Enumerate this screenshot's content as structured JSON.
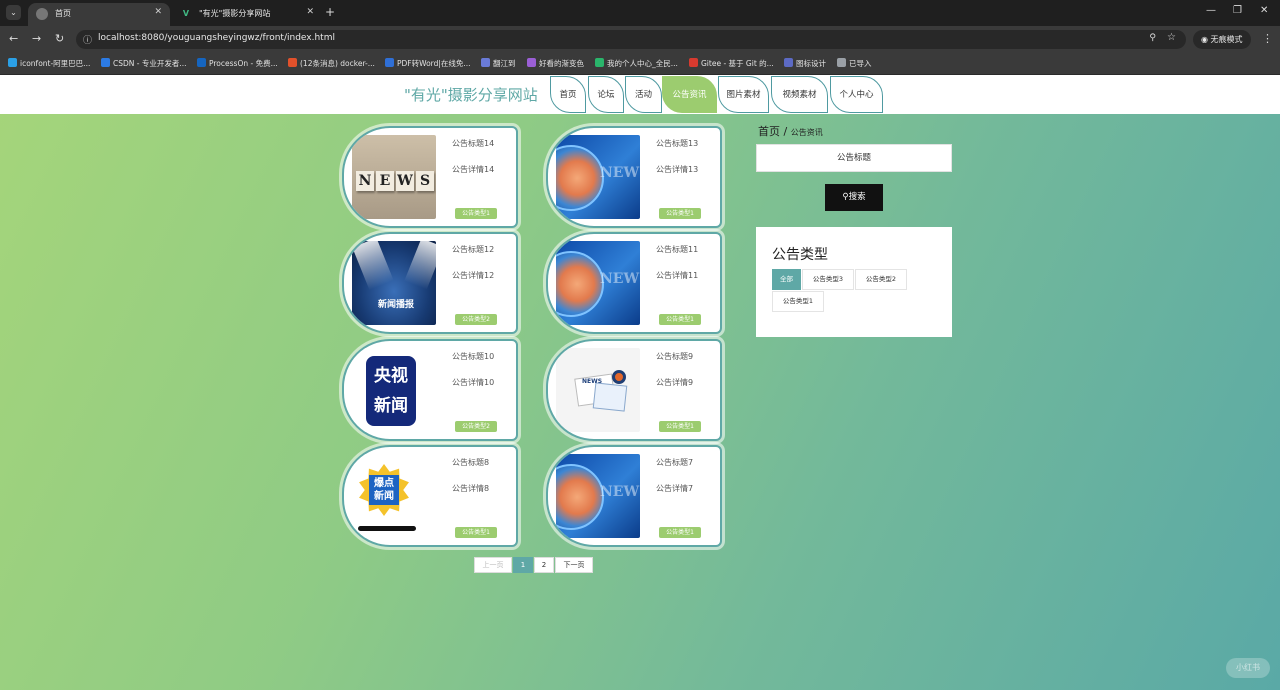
{
  "browser": {
    "tabs": [
      {
        "title": "首页",
        "active": true
      },
      {
        "title": "\"有光\"摄影分享网站",
        "active": false
      }
    ],
    "url": "localhost:8080/youguangsheyingwz/front/index.html",
    "incognito_label": "无痕模式",
    "bookmarks": [
      {
        "label": "iconfont-阿里巴巴...",
        "color": "#2ba0e6"
      },
      {
        "label": "CSDN - 专业开发者...",
        "color": "#2c7be5"
      },
      {
        "label": "ProcessOn - 免费...",
        "color": "#1565c0"
      },
      {
        "label": "(12条消息) docker-...",
        "color": "#e2512b"
      },
      {
        "label": "PDF转Word|在线免...",
        "color": "#2f6fd6"
      },
      {
        "label": "翻江到",
        "color": "#6a7bd8"
      },
      {
        "label": "好看的渐变色",
        "color": "#9b5fd6"
      },
      {
        "label": "我的个人中心_全民...",
        "color": "#2ab56b"
      },
      {
        "label": "Gitee - 基于 Git 的...",
        "color": "#d73a2f"
      },
      {
        "label": "图标设计",
        "color": "#5c6ac4"
      },
      {
        "label": "已导入",
        "color": "#9aa0a6"
      }
    ]
  },
  "site": {
    "logo": "\"有光\"摄影分享网站",
    "nav": [
      "首页",
      "论坛",
      "活动",
      "公告资讯",
      "图片素材",
      "视频素材",
      "个人中心"
    ],
    "nav_active": "公告资讯"
  },
  "cards": [
    {
      "title": "公告标题14",
      "detail": "公告详情14",
      "btn": "公告类型1",
      "thumb": "news-blocks"
    },
    {
      "title": "公告标题13",
      "detail": "公告详情13",
      "btn": "公告类型1",
      "thumb": "news-globe"
    },
    {
      "title": "公告标题12",
      "detail": "公告详情12",
      "btn": "公告类型2",
      "thumb": "news-stage"
    },
    {
      "title": "公告标题11",
      "detail": "公告详情11",
      "btn": "公告类型1",
      "thumb": "news-globe"
    },
    {
      "title": "公告标题10",
      "detail": "公告详情10",
      "btn": "公告类型2",
      "thumb": "cctv-news"
    },
    {
      "title": "公告标题9",
      "detail": "公告详情9",
      "btn": "公告类型1",
      "thumb": "news-paper"
    },
    {
      "title": "公告标题8",
      "detail": "公告详情8",
      "btn": "公告类型1",
      "thumb": "burst-news"
    },
    {
      "title": "公告标题7",
      "detail": "公告详情7",
      "btn": "公告类型1",
      "thumb": "news-globe"
    }
  ],
  "thumb_text": {
    "news_letters": [
      "N",
      "E",
      "W",
      "S"
    ],
    "globe": "NEWS",
    "stage": "新闻播报",
    "cctv": "央视\n新闻",
    "paper": "NEWS",
    "burst": "爆点\n新闻"
  },
  "pagination": {
    "prev": "上一页",
    "pages": [
      "1",
      "2"
    ],
    "current": "1",
    "next": "下一页"
  },
  "sidebar": {
    "breadcrumb_home": "首页",
    "breadcrumb_sep": "/",
    "breadcrumb_current": "公告资讯",
    "search_placeholder": "公告标题",
    "search_button": "搜索",
    "type_title": "公告类型",
    "types": [
      "全部",
      "公告类型3",
      "公告类型2",
      "公告类型1"
    ],
    "type_active": "全部"
  },
  "watermark": "小红书"
}
